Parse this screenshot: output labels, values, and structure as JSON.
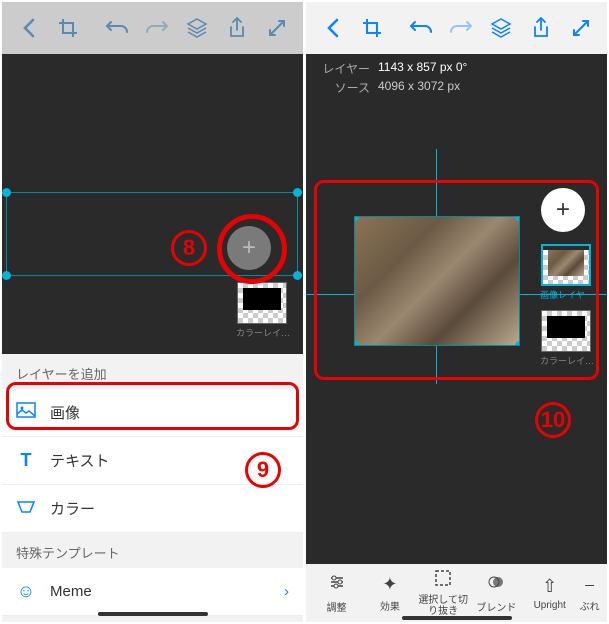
{
  "leftScreen": {
    "addLayerHeader": "レイヤーを追加",
    "menuImage": "画像",
    "menuText": "テキスト",
    "menuColor": "カラー",
    "templateHeader": "特殊テンプレート",
    "menuMeme": "Meme",
    "colorLayerThumbLabel": "カラーレイ…",
    "badge8": "8",
    "badge9": "9"
  },
  "rightScreen": {
    "layerLabel": "レイヤー",
    "layerDims": "1143 x 857 px  0°",
    "sourceLabel": "ソース",
    "sourceDims": "4096 x 3072 px",
    "imageLayerThumbLabel": "画像レイヤー",
    "colorLayerThumbLabel": "カラーレイ…",
    "badge10": "10",
    "bottomToolbar": {
      "adjust": "調整",
      "effect": "効果",
      "selectCrop": "選択して切り抜き",
      "blend": "ブレンド",
      "upright": "Upright",
      "blur": "ぶれ"
    }
  }
}
